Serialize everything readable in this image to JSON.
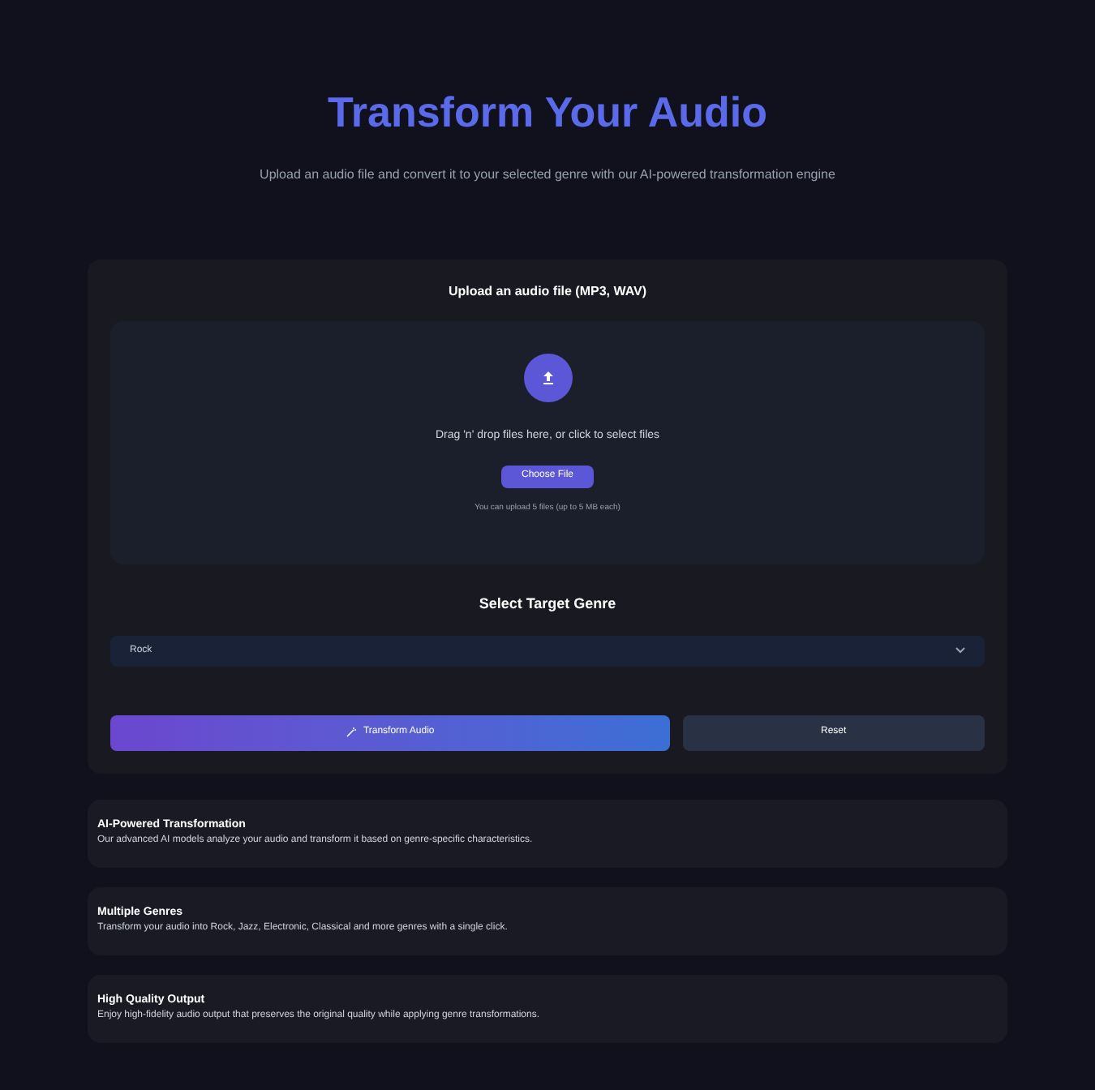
{
  "header": {
    "title": "Transform Your Audio",
    "subtitle": "Upload an audio file and convert it to your selected genre with our AI-powered transformation engine"
  },
  "upload": {
    "label": "Upload an audio file (MP3, WAV)",
    "prompt": "Drag 'n' drop files here, or click to select files",
    "button": "Choose File",
    "hint": "You can upload 5 files (up to 5 MB each)"
  },
  "genre": {
    "label": "Select Target Genre",
    "value": "Rock"
  },
  "actions": {
    "transform": "Transform Audio",
    "reset": "Reset"
  },
  "features": [
    {
      "title": "AI-Powered Transformation",
      "text": "Our advanced AI models analyze your audio and transform it based on genre-specific characteristics."
    },
    {
      "title": "Multiple Genres",
      "text": "Transform your audio into Rock, Jazz, Electronic, Classical and more genres with a single click."
    },
    {
      "title": "High Quality Output",
      "text": "Enjoy high-fidelity audio output that preserves the original quality while applying genre transformations."
    }
  ]
}
